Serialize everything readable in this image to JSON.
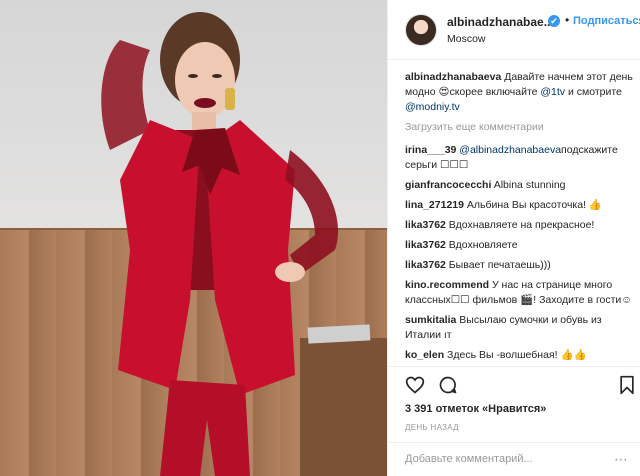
{
  "post": {
    "username": "albinadzhanabae...",
    "verified_mark": "✔",
    "separator": "•",
    "follow_label": "Подписаться",
    "location": "Moscow"
  },
  "caption": {
    "username": "albinadzhanabaeva",
    "text_1": " Давайте начнем этот день модно ",
    "emoji_1": "😍",
    "text_2": "скорее включайте ",
    "mention_1": "@1tv",
    "text_3": " и смотрите ",
    "mention_2": "@modniy.tv"
  },
  "load_more": "Загрузить еще комментарии",
  "comments": [
    {
      "user": "irina___39",
      "mention": " @albinadzhanabaeva",
      "text": "подскажите серьги ☐☐☐"
    },
    {
      "user": "gianfrancocecchi",
      "mention": "",
      "text": " Albina stunning"
    },
    {
      "user": "lina_271219",
      "mention": "",
      "text": " Альбина Вы красоточка! 👍"
    },
    {
      "user": "lika3762",
      "mention": "",
      "text": " Вдохнавляете на прекрасное!"
    },
    {
      "user": "lika3762",
      "mention": "",
      "text": " Вдохновляете"
    },
    {
      "user": "lika3762",
      "mention": "",
      "text": " Бывает печатаешь)))"
    },
    {
      "user": "kino.recommend",
      "mention": "",
      "text": " У нас на странице много классных☐☐ фильмов 🎬! Заходите в гости☺"
    },
    {
      "user": "sumkitalia",
      "mention": "",
      "text": " Высылаю сумочки и обувь из Италии ıт"
    },
    {
      "user": "ko_elen",
      "mention": "",
      "text": "  Здесь Вы -волшебная! 👍👍"
    }
  ],
  "likes": "3 391 отметок «Нравится»",
  "timestamp": "ДЕНЬ НАЗАД",
  "add_comment_placeholder": "Добавьте комментарий...",
  "more_icon": "⋯",
  "icons": [
    "heart-icon",
    "comment-icon",
    "bookmark-icon",
    "more-options-icon"
  ],
  "colors": {
    "link": "#3897f0",
    "muted": "#999999",
    "mention": "#003569",
    "suit": "#c8102e"
  }
}
